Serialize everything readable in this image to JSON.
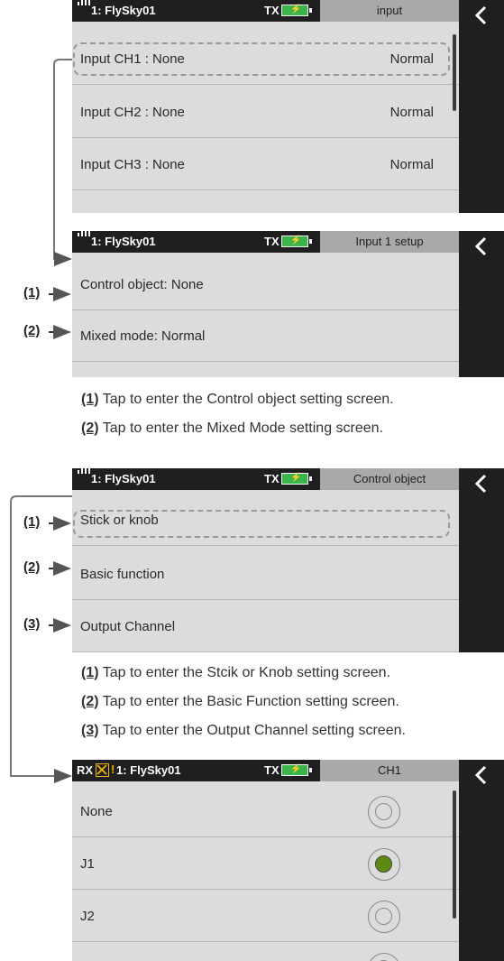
{
  "screens": [
    {
      "status": {
        "model": "1: FlySky01",
        "tx": "TX",
        "title": "input"
      },
      "rows": [
        {
          "left": "Input CH1  : None",
          "right": "Normal"
        },
        {
          "left": "Input CH2  : None",
          "right": "Normal"
        },
        {
          "left": "Input CH3  : None",
          "right": "Normal"
        }
      ]
    },
    {
      "status": {
        "model": "1: FlySky01",
        "tx": "TX",
        "title": "Input  1  setup"
      },
      "rows": [
        {
          "left": "Control  object: None"
        },
        {
          "left": "Mixed  mode: Normal"
        }
      ]
    },
    {
      "status": {
        "model": "1: FlySky01",
        "tx": "TX",
        "title": "Control  object"
      },
      "rows": [
        {
          "left": "Stick  or  knob"
        },
        {
          "left": "Basic  function"
        },
        {
          "left": "Output  Channel"
        }
      ]
    },
    {
      "status": {
        "rx": "RX",
        "model": "1: FlySky01",
        "tx": "TX",
        "title": "CH1"
      },
      "rows": [
        {
          "left": "None",
          "selected": false
        },
        {
          "left": "J1",
          "selected": true
        },
        {
          "left": "J2",
          "selected": false
        }
      ]
    }
  ],
  "callouts": {
    "one": "(1)",
    "two": "(2)",
    "three": "(3)"
  },
  "notes_setup": [
    {
      "num": "(1)",
      "text": " Tap to enter the Control object setting screen."
    },
    {
      "num": "(2)",
      "text": " Tap to enter the Mixed Mode setting screen."
    }
  ],
  "notes_control": [
    {
      "num": "(1)",
      "text": " Tap to enter the Stcik or Knob setting screen."
    },
    {
      "num": "(2)",
      "text": " Tap to enter the Basic Function setting screen."
    },
    {
      "num": "(3)",
      "text": " Tap to enter the Output Channel setting screen."
    }
  ],
  "colors": {
    "battery": "#39b54a",
    "radio_selected": "#5c8a14",
    "rx_warning": "#f0b400"
  }
}
